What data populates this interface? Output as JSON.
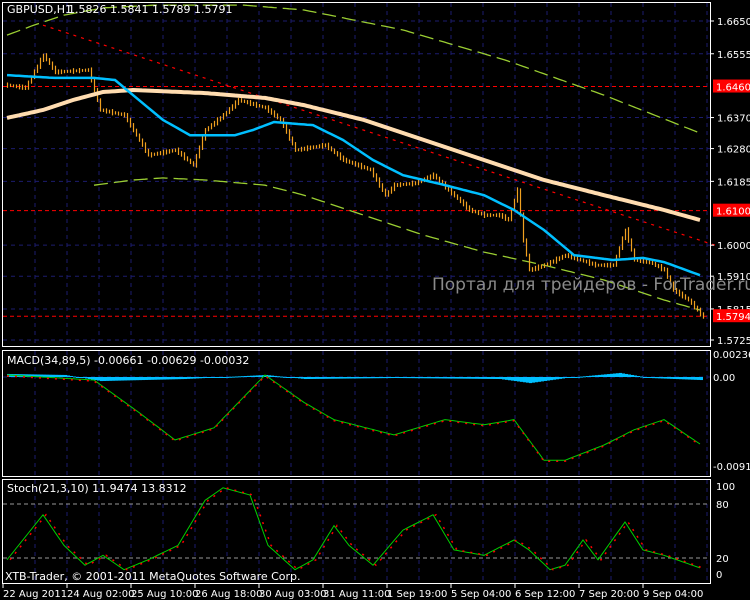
{
  "header": {
    "symbol": "GBPUSD,H1",
    "ohlc": "1.5826 1.5841 1.5789 1.5791"
  },
  "watermark": "Портал для трейдеров - ForTrader.ru",
  "copyright": "XTB-Trader, © 2001-2011 MetaQuotes Software Corp.",
  "colors": {
    "bars": "#f0a020",
    "ma_fast": "#00bfff",
    "ma_slow": "#ffdcb0",
    "envelope": "#9acd32",
    "trend": "#ff0000",
    "grid": "#1c1c6e",
    "level_label": "#ff0000"
  },
  "price_axis": {
    "labels": [
      "1.6650",
      "1.6555",
      "1.6370",
      "1.6280",
      "1.6185",
      "1.6000",
      "1.5910",
      "1.5815",
      "1.5725"
    ],
    "values": [
      1.665,
      1.6555,
      1.637,
      1.628,
      1.6185,
      1.6,
      1.591,
      1.5815,
      1.5725
    ]
  },
  "levels": [
    {
      "label": "1.6460",
      "value": 1.646
    },
    {
      "label": "1.6100",
      "value": 1.61
    },
    {
      "label": "1.5794",
      "value": 1.5794
    }
  ],
  "time_axis": [
    "22 Aug 2011",
    "24 Aug 02:00",
    "25 Aug 10:00",
    "26 Aug 18:00",
    "30 Aug 03:00",
    "31 Aug 11:00",
    "1 Sep 19:00",
    "5 Sep 04:00",
    "6 Sep 12:00",
    "7 Sep 20:00",
    "9 Sep 04:00"
  ],
  "macd": {
    "label": "MACD(34,89,5) -0.00661 -0.00629 -0.00032",
    "axis": [
      "0.00236",
      "0.00",
      "-0.00916"
    ]
  },
  "stoch": {
    "label": "Stoch(21,3,10) 11.9474 13.8312",
    "axis": [
      "100",
      "80",
      "20",
      "0"
    ]
  },
  "chart_data": {
    "type": "bar",
    "bar_count": 234,
    "price_path": [
      [
        1,
        1.6464
      ],
      [
        7,
        1.6456
      ],
      [
        13,
        1.6551
      ],
      [
        17,
        1.6502
      ],
      [
        28,
        1.6508
      ],
      [
        32,
        1.6392
      ],
      [
        40,
        1.6377
      ],
      [
        48,
        1.6261
      ],
      [
        57,
        1.6276
      ],
      [
        63,
        1.6232
      ],
      [
        67,
        1.6334
      ],
      [
        73,
        1.6377
      ],
      [
        78,
        1.6421
      ],
      [
        87,
        1.6398
      ],
      [
        92,
        1.6363
      ],
      [
        97,
        1.6276
      ],
      [
        107,
        1.629
      ],
      [
        113,
        1.6247
      ],
      [
        122,
        1.6218
      ],
      [
        127,
        1.6145
      ],
      [
        130,
        1.6174
      ],
      [
        137,
        1.618
      ],
      [
        143,
        1.6203
      ],
      [
        148,
        1.616
      ],
      [
        155,
        1.6102
      ],
      [
        160,
        1.6087
      ],
      [
        165,
        1.6087
      ],
      [
        168,
        1.6073
      ],
      [
        171,
        1.616
      ],
      [
        173,
        1.6015
      ],
      [
        175,
        1.5928
      ],
      [
        180,
        1.5942
      ],
      [
        187,
        1.5971
      ],
      [
        192,
        1.5957
      ],
      [
        197,
        1.5942
      ],
      [
        203,
        1.5942
      ],
      [
        207,
        1.6044
      ],
      [
        210,
        1.5957
      ],
      [
        215,
        1.5951
      ],
      [
        220,
        1.5928
      ],
      [
        223,
        1.587
      ],
      [
        228,
        1.5841
      ],
      [
        233,
        1.5791
      ]
    ],
    "ma_fast": [
      [
        1,
        1.6493
      ],
      [
        17,
        1.6485
      ],
      [
        30,
        1.6485
      ],
      [
        37,
        1.6479
      ],
      [
        43,
        1.6435
      ],
      [
        53,
        1.6363
      ],
      [
        62,
        1.6319
      ],
      [
        77,
        1.6319
      ],
      [
        83,
        1.6334
      ],
      [
        90,
        1.6357
      ],
      [
        103,
        1.6348
      ],
      [
        113,
        1.6305
      ],
      [
        123,
        1.6247
      ],
      [
        133,
        1.6203
      ],
      [
        147,
        1.6174
      ],
      [
        160,
        1.6145
      ],
      [
        170,
        1.6102
      ],
      [
        180,
        1.6044
      ],
      [
        190,
        1.5971
      ],
      [
        203,
        1.5957
      ],
      [
        213,
        1.5963
      ],
      [
        220,
        1.5951
      ],
      [
        232,
        1.5913
      ]
    ],
    "ma_slow": [
      [
        1,
        1.6369
      ],
      [
        13,
        1.6392
      ],
      [
        23,
        1.6421
      ],
      [
        33,
        1.6444
      ],
      [
        43,
        1.645
      ],
      [
        67,
        1.6441
      ],
      [
        87,
        1.6427
      ],
      [
        100,
        1.6406
      ],
      [
        120,
        1.6363
      ],
      [
        140,
        1.6305
      ],
      [
        160,
        1.6247
      ],
      [
        180,
        1.6189
      ],
      [
        200,
        1.6145
      ],
      [
        220,
        1.6102
      ],
      [
        232,
        1.6073
      ]
    ],
    "envelope_upper": [
      [
        1,
        1.6609
      ],
      [
        10,
        1.6638
      ],
      [
        20,
        1.6667
      ],
      [
        33,
        1.6688
      ],
      [
        50,
        1.6696
      ],
      [
        80,
        1.6696
      ],
      [
        100,
        1.6682
      ],
      [
        133,
        1.6624
      ],
      [
        167,
        1.6537
      ],
      [
        200,
        1.6435
      ],
      [
        232,
        1.6325
      ]
    ],
    "envelope_lower": [
      [
        30,
        1.6174
      ],
      [
        43,
        1.6189
      ],
      [
        53,
        1.6195
      ],
      [
        67,
        1.6189
      ],
      [
        87,
        1.6174
      ],
      [
        100,
        1.6145
      ],
      [
        120,
        1.6087
      ],
      [
        140,
        1.6029
      ],
      [
        160,
        1.598
      ],
      [
        180,
        1.5942
      ],
      [
        200,
        1.5899
      ],
      [
        220,
        1.5841
      ],
      [
        232,
        1.5812
      ]
    ],
    "trendline": [
      [
        13,
        1.6638
      ],
      [
        237,
        1.6
      ]
    ],
    "price_range": [
      1.5725,
      1.665
    ],
    "macd_main": [
      [
        1,
        0.0002
      ],
      [
        30,
        -0.0003
      ],
      [
        45,
        -0.0035
      ],
      [
        57,
        -0.0062
      ],
      [
        70,
        -0.005
      ],
      [
        87,
        0.0002
      ],
      [
        100,
        -0.0025
      ],
      [
        110,
        -0.0042
      ],
      [
        130,
        -0.0057
      ],
      [
        147,
        -0.0042
      ],
      [
        160,
        -0.0047
      ],
      [
        170,
        -0.0042
      ],
      [
        180,
        -0.0082
      ],
      [
        187,
        -0.0082
      ],
      [
        200,
        -0.0067
      ],
      [
        210,
        -0.0052
      ],
      [
        220,
        -0.0042
      ],
      [
        232,
        -0.0066
      ]
    ],
    "macd_hist": [
      [
        1,
        0.0003
      ],
      [
        20,
        0.0002
      ],
      [
        32,
        -0.0004
      ],
      [
        60,
        -0.0002
      ],
      [
        87,
        0.0002
      ],
      [
        100,
        -0.0002
      ],
      [
        130,
        -0.0001
      ],
      [
        165,
        -0.0002
      ],
      [
        175,
        -0.0006
      ],
      [
        187,
        -0.0001
      ],
      [
        205,
        0.0004
      ],
      [
        215,
        -0.0001
      ],
      [
        232,
        -0.0003
      ]
    ],
    "macd_range": [
      -0.00916,
      0.00236
    ],
    "stoch_main": [
      [
        1,
        18
      ],
      [
        13,
        68
      ],
      [
        20,
        34
      ],
      [
        27,
        12
      ],
      [
        33,
        23
      ],
      [
        40,
        7
      ],
      [
        48,
        18
      ],
      [
        58,
        34
      ],
      [
        67,
        84
      ],
      [
        73,
        98
      ],
      [
        82,
        90
      ],
      [
        88,
        34
      ],
      [
        97,
        7
      ],
      [
        103,
        18
      ],
      [
        110,
        56
      ],
      [
        115,
        34
      ],
      [
        123,
        12
      ],
      [
        133,
        51
      ],
      [
        143,
        68
      ],
      [
        150,
        29
      ],
      [
        160,
        23
      ],
      [
        170,
        40
      ],
      [
        175,
        29
      ],
      [
        182,
        7
      ],
      [
        187,
        12
      ],
      [
        193,
        40
      ],
      [
        198,
        18
      ],
      [
        207,
        60
      ],
      [
        213,
        29
      ],
      [
        220,
        23
      ],
      [
        232,
        9
      ]
    ],
    "stoch_range": [
      0,
      100
    ]
  }
}
